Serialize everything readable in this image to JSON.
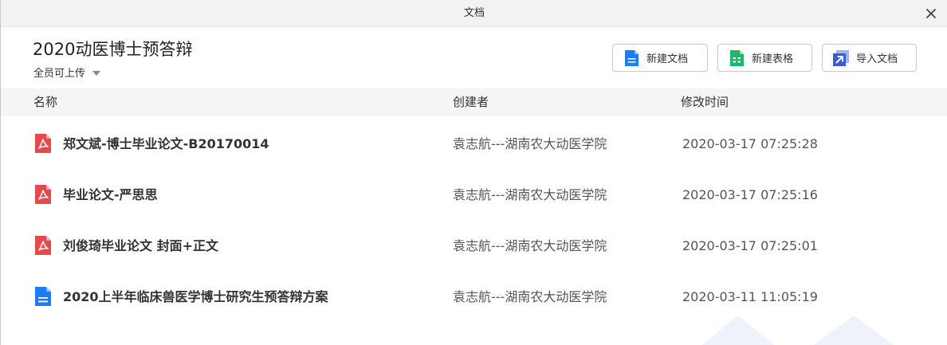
{
  "window": {
    "title": "文档"
  },
  "header": {
    "title": "2020动医博士预答辩",
    "permission": "全员可上传"
  },
  "actions": {
    "new_doc": "新建文档",
    "new_sheet": "新建表格",
    "import_doc": "导入文档"
  },
  "table": {
    "headers": {
      "name": "名称",
      "creator": "创建者",
      "modified": "修改时间"
    },
    "rows": [
      {
        "icon": "pdf-icon",
        "name": "郑文斌-博士毕业论文-B20170014",
        "creator": "袁志航---湖南农大动医学院",
        "modified": "2020-03-17 07:25:28"
      },
      {
        "icon": "pdf-icon",
        "name": "毕业论文-严思思",
        "creator": "袁志航---湖南农大动医学院",
        "modified": "2020-03-17 07:25:16"
      },
      {
        "icon": "pdf-icon",
        "name": "刘俊琦毕业论文 封面+正文",
        "creator": "袁志航---湖南农大动医学院",
        "modified": "2020-03-17 07:25:01"
      },
      {
        "icon": "doc-icon",
        "name": "2020上半年临床兽医学博士研究生预答辩方案",
        "creator": "袁志航---湖南农大动医学院",
        "modified": "2020-03-11 11:05:19"
      }
    ]
  },
  "colors": {
    "pdf": "#e5484d",
    "doc": "#1e7cf2",
    "sheet": "#1fb866",
    "import": "#3a5bd9",
    "header_bg": "#f4f5f7",
    "titlebar_bg": "#f2f2f2"
  }
}
